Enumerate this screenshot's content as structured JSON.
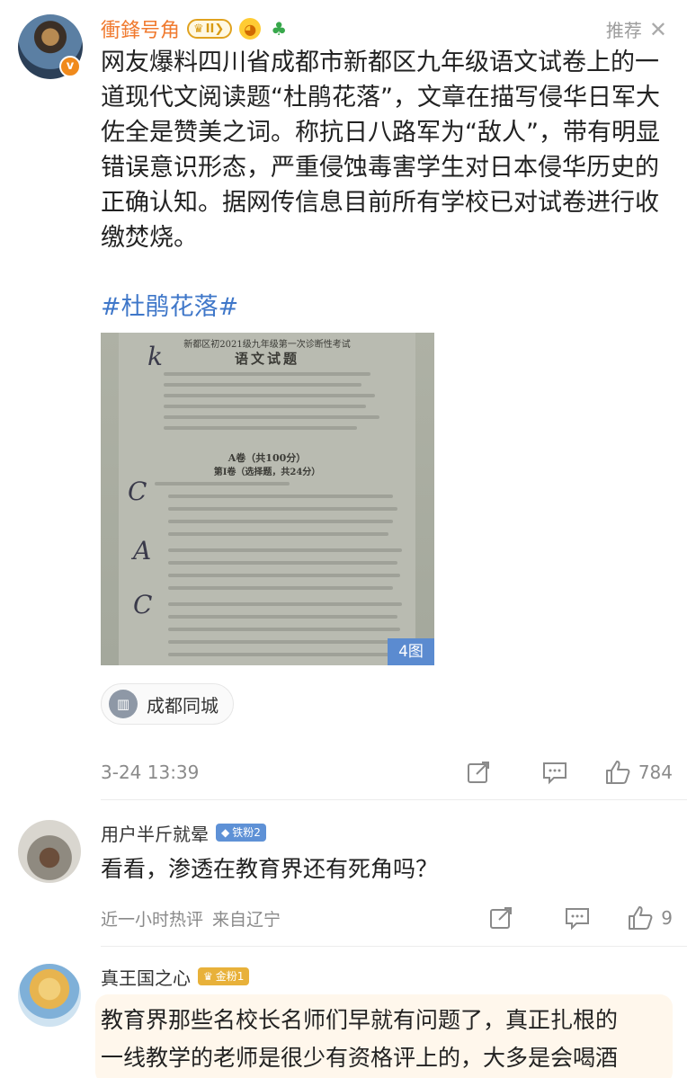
{
  "post": {
    "author": "衝鋒号角",
    "vip_level": "II",
    "recommend_label": "推荐",
    "text": "网友爆料四川省成都市新都区九年级语文试卷上的一道现代文阅读题“杜鹃花落”，文章在描写侵华日军大佐全是赞美之词。称抗日八路军为“敌人”，带有明显错误意识形态，严重侵蚀毒害学生对日本侵华历史的正确认知。据网传信息目前所有学校已对试卷进行收缴焚烧。",
    "hashtag": "#杜鹃花落#",
    "image": {
      "header_line": "新都区初2021级九年级第一次诊断性考试",
      "title": "语文试题",
      "section_a": "A卷（共100分）",
      "section_1": "第Ⅰ卷（选择题，共24分）",
      "count_label": "4图"
    },
    "location": "成都同城",
    "time": "3-24 13:39",
    "like_count": "784"
  },
  "comments": [
    {
      "name": "用户半斤就晕",
      "badge": "铁粉2",
      "text": "看看，渗透在教育界还有死角吗？",
      "meta_hot": "近一小时热评",
      "meta_loc": "来自辽宁",
      "like_count": "9"
    },
    {
      "name": "真王国之心",
      "badge": "金粉1",
      "text_line1": "教育界那些名校长名师们早就有问题了，真正扎根的",
      "text_line2": "一线教学的老师是很少有资格评上的，大多是会喝酒"
    }
  ],
  "colors": {
    "author_orange": "#f07a2f",
    "link_blue": "#3f77c9",
    "meta_gray": "#8a8a8a"
  }
}
